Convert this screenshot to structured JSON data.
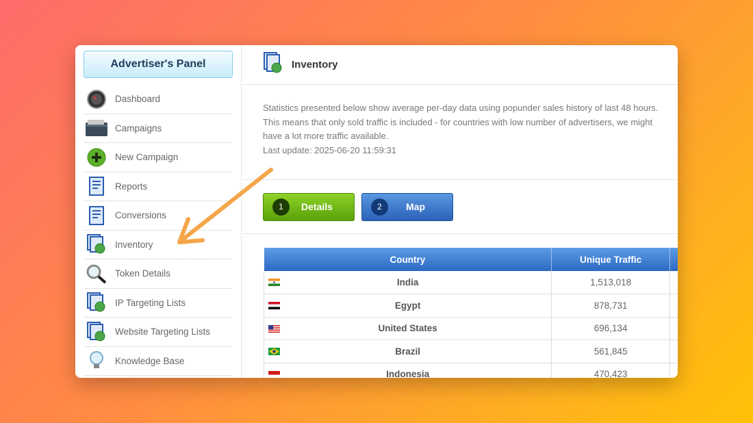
{
  "sidebar": {
    "panel_title": "Advertiser's Panel",
    "items": [
      {
        "label": "Dashboard",
        "icon": "gauge-icon"
      },
      {
        "label": "Campaigns",
        "icon": "wallet-icon"
      },
      {
        "label": "New Campaign",
        "icon": "plus-circle-icon"
      },
      {
        "label": "Reports",
        "icon": "report-icon"
      },
      {
        "label": "Conversions",
        "icon": "report-icon"
      },
      {
        "label": "Inventory",
        "icon": "inventory-icon"
      },
      {
        "label": "Token Details",
        "icon": "magnifier-icon"
      },
      {
        "label": "IP Targeting Lists",
        "icon": "inventory-icon"
      },
      {
        "label": "Website Targeting Lists",
        "icon": "inventory-icon"
      },
      {
        "label": "Knowledge Base",
        "icon": "lightbulb-icon"
      }
    ]
  },
  "header": {
    "title": "Inventory",
    "icon": "inventory-icon"
  },
  "description": {
    "line1": "Statistics presented below show average per-day data using popunder sales history of last 48 hours.",
    "line2": "This means that only sold traffic is included - for countries with low number of advertisers, we might",
    "line3": "have a lot more traffic available.",
    "line4": "Last update: 2025-06-20 11:59:31"
  },
  "tabs": [
    {
      "number": "1",
      "label": "Details",
      "color": "#6cb516"
    },
    {
      "number": "2",
      "label": "Map",
      "color": "#3a78cf"
    }
  ],
  "table": {
    "headers": [
      "Country",
      "Unique Traffic"
    ],
    "rows": [
      {
        "country": "India",
        "traffic": "1,513,018",
        "flag": "india-flag-icon"
      },
      {
        "country": "Egypt",
        "traffic": "878,731",
        "flag": "egypt-flag-icon"
      },
      {
        "country": "United States",
        "traffic": "696,134",
        "flag": "us-flag-icon"
      },
      {
        "country": "Brazil",
        "traffic": "561,845",
        "flag": "brazil-flag-icon"
      },
      {
        "country": "Indonesia",
        "traffic": "470,423",
        "flag": "indonesia-flag-icon"
      }
    ]
  },
  "colors": {
    "arrow": "#f5a54a",
    "header_blue": "#2c68c2",
    "panel_border": "#8ac9ea"
  }
}
